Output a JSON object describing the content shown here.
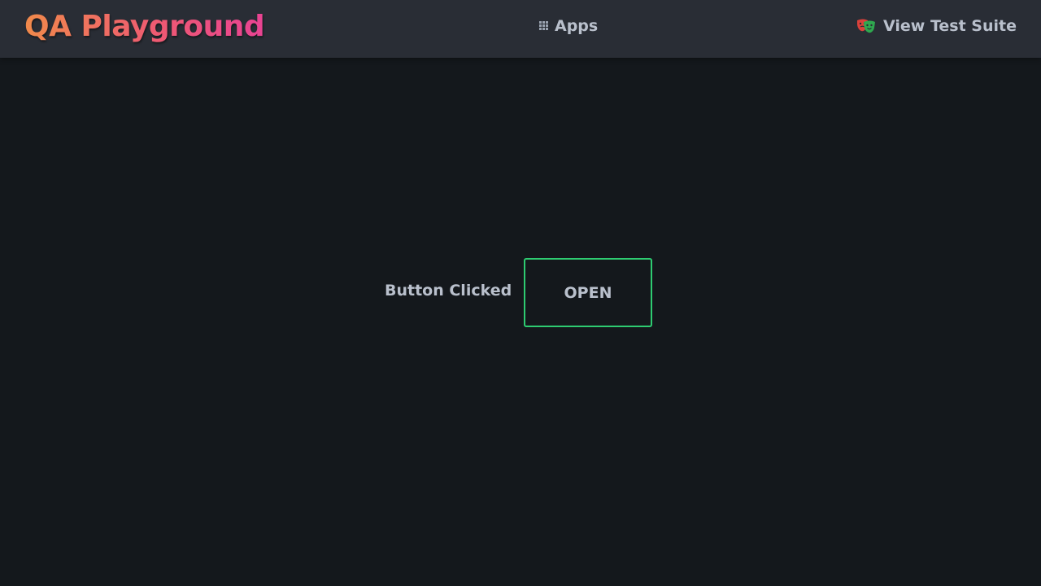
{
  "navbar": {
    "brand": "QA Playground",
    "apps_label": "Apps",
    "apps_icon": "grid-icon",
    "suite_label": "View Test Suite",
    "suite_icon": "theater-masks-icon"
  },
  "main": {
    "status_text": "Button Clicked",
    "button_label": "OPEN"
  },
  "colors": {
    "background": "#14181c",
    "navbar": "#292d35",
    "brand_gradient_start": "#f08a4b",
    "brand_gradient_end": "#e94393",
    "text": "#b9c0cc",
    "button_border": "#2ecc71"
  }
}
